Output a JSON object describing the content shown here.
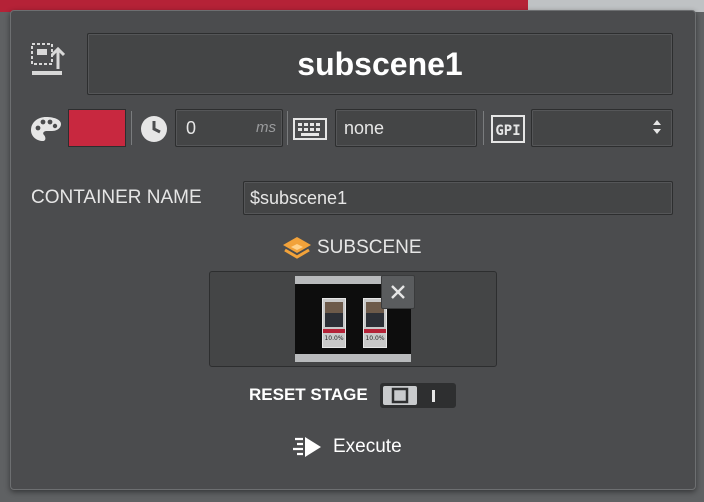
{
  "header": {
    "title": "subscene1"
  },
  "properties": {
    "color_hex": "#c8283f",
    "delay_value": "0",
    "delay_unit": "ms",
    "keyboard_value": "none",
    "gpi_value": ""
  },
  "container": {
    "label": "CONTAINER NAME",
    "value": "$subscene1"
  },
  "subscene": {
    "label": "SUBSCENE",
    "thumbnail_cards": [
      "10.0%",
      "10.0%"
    ]
  },
  "reset_stage": {
    "label": "RESET STAGE",
    "toggle_state": "I"
  },
  "execute": {
    "label": "Execute"
  },
  "colors": {
    "accent_orange": "#f2a23a",
    "swatch_red": "#c8283f",
    "panel_bg": "#4b4c4e"
  },
  "icons": [
    "export-template-icon",
    "palette-icon",
    "clock-icon",
    "keyboard-icon",
    "gpi-icon",
    "layers-icon",
    "close-icon",
    "execute-icon"
  ]
}
